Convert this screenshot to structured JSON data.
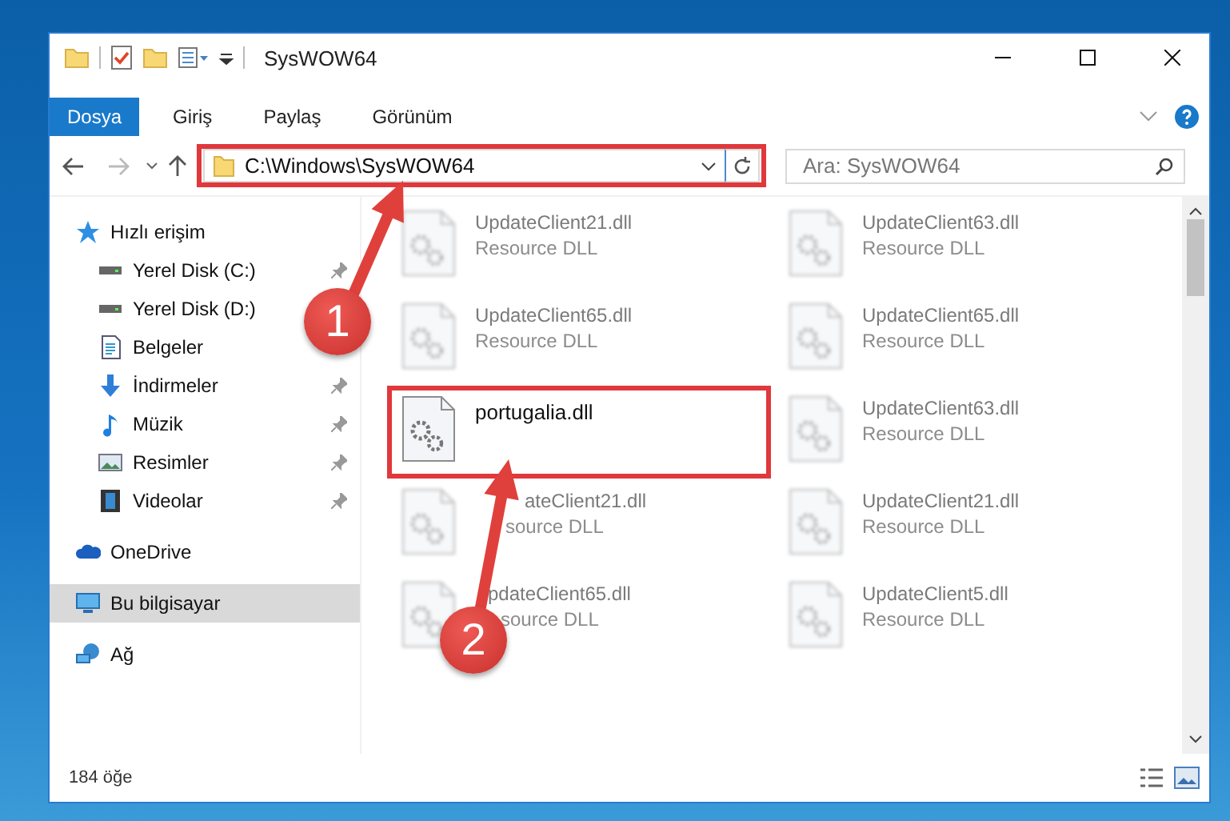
{
  "window": {
    "title": "SysWOW64"
  },
  "ribbon_tabs": [
    {
      "label": "Dosya",
      "selected": true
    },
    {
      "label": "Giriş",
      "selected": false
    },
    {
      "label": "Paylaş",
      "selected": false
    },
    {
      "label": "Görünüm",
      "selected": false
    }
  ],
  "address": {
    "path": "C:\\Windows\\SysWOW64",
    "highlighted": true
  },
  "search": {
    "placeholder": "Ara: SysWOW64"
  },
  "nav": [
    {
      "label": "Hızlı erişim",
      "kind": "star",
      "selected": false,
      "children": [
        {
          "label": "Yerel Disk (C:)",
          "kind": "disk",
          "pinned": true,
          "selected": false
        },
        {
          "label": "Yerel Disk (D:)",
          "kind": "disk",
          "pinned": false,
          "selected": false
        },
        {
          "label": "Belgeler",
          "kind": "document",
          "pinned": false,
          "selected": false
        },
        {
          "label": "İndirmeler",
          "kind": "download",
          "pinned": true,
          "selected": false
        },
        {
          "label": "Müzik",
          "kind": "music",
          "pinned": true,
          "selected": false
        },
        {
          "label": "Resimler",
          "kind": "pictures",
          "pinned": true,
          "selected": false
        },
        {
          "label": "Videolar",
          "kind": "video",
          "pinned": true,
          "selected": false
        }
      ]
    },
    {
      "label": "OneDrive",
      "kind": "cloud",
      "selected": false
    },
    {
      "label": "Bu bilgisayar",
      "kind": "computer",
      "selected": true
    },
    {
      "label": "Ağ",
      "kind": "network",
      "selected": false
    }
  ],
  "files": [
    {
      "name": "UpdateClient21.dll",
      "type": "Resource DLL",
      "dimmed": true,
      "highlighted": false
    },
    {
      "name": "UpdateClient63.dll",
      "type": "Resource DLL",
      "dimmed": true,
      "highlighted": false
    },
    {
      "name": "UpdateClient65.dll",
      "type": "Resource DLL",
      "dimmed": true,
      "highlighted": false
    },
    {
      "name": "UpdateClient65.dll",
      "type": "Resource DLL",
      "dimmed": true,
      "highlighted": false
    },
    {
      "name": "portugalia.dll",
      "dimmed": false,
      "highlighted": true
    },
    {
      "name": "UpdateClient63.dll",
      "type": "Resource DLL",
      "dimmed": true,
      "highlighted": false
    },
    {
      "name": "ateClient21.dll",
      "type": "source DLL",
      "dimmed": true,
      "highlighted": false
    },
    {
      "name": "UpdateClient21.dll",
      "type": "Resource DLL",
      "dimmed": true,
      "highlighted": false
    },
    {
      "name": "pdateClient65.dll",
      "type": "source DLL",
      "dimmed": true,
      "highlighted": false
    },
    {
      "name": "UpdateClient5.dll",
      "type": "Resource DLL",
      "dimmed": true,
      "highlighted": false
    }
  ],
  "annotations": [
    {
      "number": "1"
    },
    {
      "number": "2"
    }
  ],
  "status_bar": {
    "count": "184 öğe"
  }
}
